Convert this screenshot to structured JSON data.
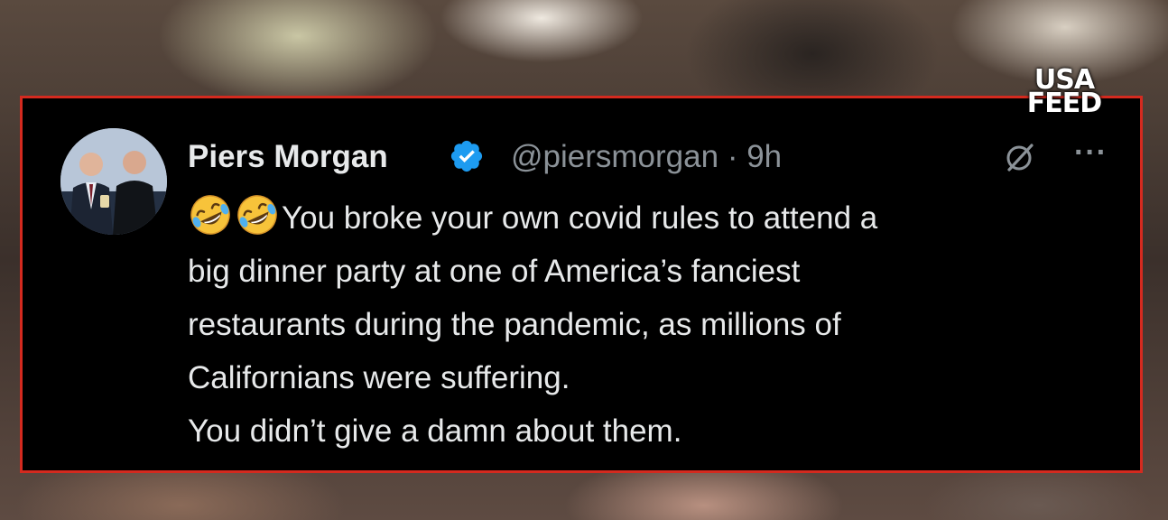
{
  "brand": {
    "logo_line1": "USA",
    "logo_line2": "FEED"
  },
  "tweet": {
    "author_name": "Piers Morgan",
    "handle": "@piersmorgan",
    "separator": "·",
    "time": "9h",
    "emojis": [
      "rolling-on-floor-laughing",
      "rolling-on-floor-laughing"
    ],
    "lines": [
      "You broke your own covid rules to attend a",
      "big dinner party at one of America’s fanciest",
      "restaurants during the pandemic, as millions of",
      "Californians were suffering.",
      "You didn’t give a damn about them."
    ],
    "more_label": "···"
  },
  "colors": {
    "border": "#d42a1f",
    "verified": "#1d9bf0",
    "text": "#e7e9ea",
    "muted": "#8b9298",
    "card_bg": "#000000"
  }
}
